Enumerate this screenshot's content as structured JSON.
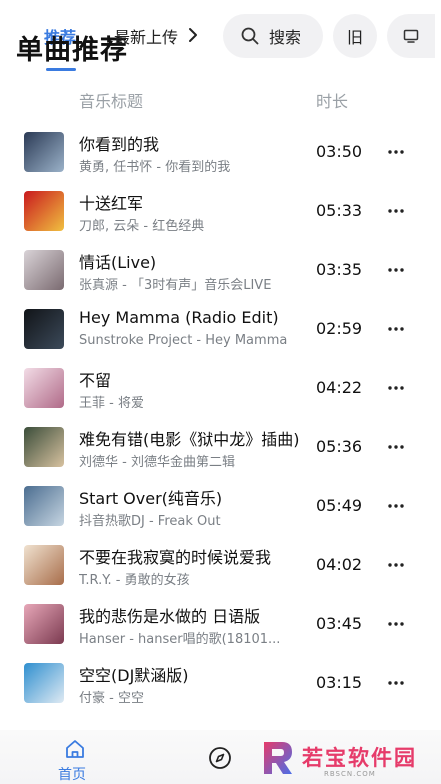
{
  "header": {
    "title": "单曲推荐",
    "tab_recommend": "推荐",
    "tab_latest": "最新上传",
    "search_label": "搜索",
    "old_label": "旧"
  },
  "columns": {
    "title": "音乐标题",
    "duration": "时长"
  },
  "songs": [
    {
      "title": "你看到的我",
      "subtitle": "黄勇, 任书怀 - 你看到的我",
      "duration": "03:50",
      "cover_colors": [
        "#2b3a55",
        "#9bb2c9"
      ]
    },
    {
      "title": "十送红军",
      "subtitle": "刀郎, 云朵 - 红色经典",
      "duration": "05:33",
      "cover_colors": [
        "#c9191e",
        "#f0c040"
      ]
    },
    {
      "title": "情话(Live)",
      "subtitle": "张真源 - 「3时有声」音乐会LIVE",
      "duration": "03:35",
      "cover_colors": [
        "#d9d3d7",
        "#7a6a70"
      ]
    },
    {
      "title": "Hey Mamma (Radio Edit)",
      "subtitle": "Sunstroke Project - Hey Mamma",
      "duration": "02:59",
      "cover_colors": [
        "#111418",
        "#3c4a5a"
      ]
    },
    {
      "title": "不留",
      "subtitle": "王菲 - 将爱",
      "duration": "04:22",
      "cover_colors": [
        "#f2dce6",
        "#b06a88"
      ]
    },
    {
      "title": "难免有错(电影《狱中龙》插曲)",
      "subtitle": "刘德华 - 刘德华金曲第二辑",
      "duration": "05:36",
      "cover_colors": [
        "#3a4d3a",
        "#d8c2a0"
      ]
    },
    {
      "title": "Start Over(纯音乐)",
      "subtitle": "抖音热歌DJ - Freak Out",
      "duration": "05:49",
      "cover_colors": [
        "#4b6d90",
        "#c7d6e2"
      ]
    },
    {
      "title": "不要在我寂寞的时候说爱我",
      "subtitle": "T.R.Y. - 勇敢的女孩",
      "duration": "04:02",
      "cover_colors": [
        "#f0e2d0",
        "#a86d4a"
      ]
    },
    {
      "title": "我的悲伤是水做的 日语版",
      "subtitle": "Hanser - hanser唱的歌(18101...",
      "duration": "03:45",
      "cover_colors": [
        "#e7a7b8",
        "#7b3a50"
      ]
    },
    {
      "title": "空空(DJ默涵版)",
      "subtitle": "付豪 - 空空",
      "duration": "03:15",
      "cover_colors": [
        "#2f8fcf",
        "#dfeaf3"
      ]
    }
  ],
  "bottom_nav": {
    "home_label": "首页",
    "watermark_text": "若宝软件园",
    "watermark_sub": "RBSCN.COM"
  },
  "colors": {
    "accent": "#3a7be0",
    "secondary_text": "#7a7f85",
    "pill_bg": "#f1f1f3"
  },
  "icons": {
    "search": "search-icon",
    "tv": "tv-icon",
    "more": "more-icon",
    "home": "home-icon",
    "discover": "compass-icon"
  }
}
